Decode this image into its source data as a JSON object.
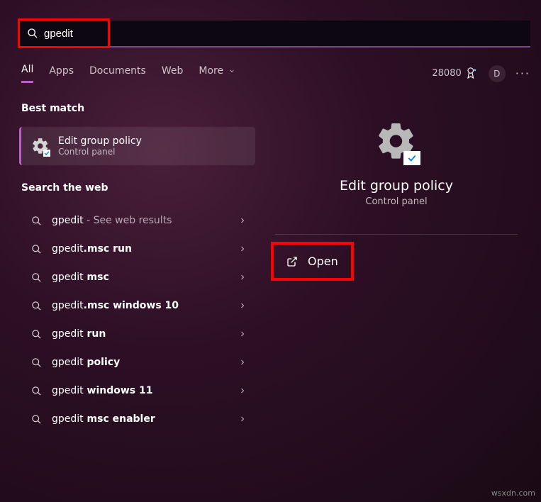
{
  "search": {
    "value": "gpedit"
  },
  "tabs": {
    "items": [
      "All",
      "Apps",
      "Documents",
      "Web",
      "More"
    ],
    "active": 0
  },
  "rewards": {
    "points": "28080"
  },
  "avatar": {
    "initial": "D"
  },
  "best_match": {
    "label": "Best match",
    "title": "Edit group policy",
    "subtitle": "Control panel"
  },
  "web_section": {
    "label": "Search the web"
  },
  "web_items": [
    {
      "prefix": "gpedit",
      "suffix": "",
      "extra": " - See web results"
    },
    {
      "prefix": "gpedit",
      "suffix": ".msc run",
      "extra": ""
    },
    {
      "prefix": "gpedit",
      "suffix": " msc",
      "extra": ""
    },
    {
      "prefix": "gpedit",
      "suffix": ".msc windows 10",
      "extra": ""
    },
    {
      "prefix": "gpedit",
      "suffix": " run",
      "extra": ""
    },
    {
      "prefix": "gpedit",
      "suffix": " policy",
      "extra": ""
    },
    {
      "prefix": "gpedit",
      "suffix": " windows 11",
      "extra": ""
    },
    {
      "prefix": "gpedit",
      "suffix": " msc enabler",
      "extra": ""
    }
  ],
  "detail": {
    "title": "Edit group policy",
    "subtitle": "Control panel",
    "open_label": "Open"
  },
  "watermark": "wsxdn.com"
}
